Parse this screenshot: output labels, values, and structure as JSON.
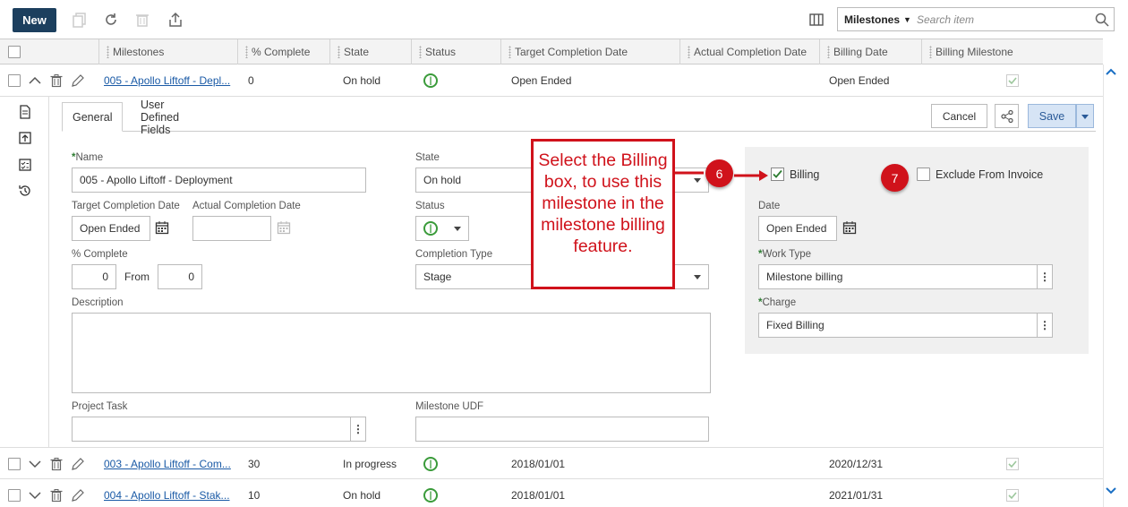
{
  "toolbar": {
    "new_label": "New",
    "search_scope": "Milestones",
    "search_placeholder": "Search item"
  },
  "columns": [
    "Milestones",
    "% Complete",
    "State",
    "Status",
    "Target Completion Date",
    "Actual Completion Date",
    "Billing Date",
    "Billing Milestone"
  ],
  "rows": [
    {
      "milestone": "005 - Apollo Liftoff - Depl...",
      "complete": "0",
      "state": "On hold",
      "target": "Open Ended",
      "actual": "",
      "billing_date": "Open Ended",
      "billing": true
    },
    {
      "milestone": "003 - Apollo Liftoff - Com...",
      "complete": "30",
      "state": "In progress",
      "target": "2018/01/01",
      "actual": "",
      "billing_date": "2020/12/31",
      "billing": true
    },
    {
      "milestone": "004 - Apollo Liftoff - Stak...",
      "complete": "10",
      "state": "On hold",
      "target": "2018/01/01",
      "actual": "",
      "billing_date": "2021/01/31",
      "billing": true
    }
  ],
  "tabs": {
    "general": "General",
    "udf": "User Defined Fields"
  },
  "actions": {
    "cancel": "Cancel",
    "save": "Save"
  },
  "form": {
    "name_label": "Name",
    "name_value": "005 - Apollo Liftoff - Deployment",
    "target_label": "Target Completion Date",
    "target_value": "Open Ended",
    "actual_label": "Actual Completion Date",
    "actual_value": "",
    "complete_label": "% Complete",
    "complete_value": "0",
    "from_label": "From",
    "from_value": "0",
    "description_label": "Description",
    "project_task_label": "Project Task",
    "milestone_udf_label": "Milestone UDF",
    "state_label": "State",
    "state_value": "On hold",
    "status_label": "Status",
    "completion_type_label": "Completion Type",
    "completion_type_value": "Stage",
    "billing_label": "Billing",
    "exclude_label": "Exclude From Invoice",
    "date_label": "Date",
    "date_value": "Open Ended",
    "work_type_label": "Work Type",
    "work_type_value": "Milestone billing",
    "charge_label": "Charge",
    "charge_value": "Fixed Billing",
    "billing_checked": true,
    "exclude_checked": false
  },
  "callout": {
    "text": "Select the Billing box, to use this milestone in the milestone billing feature.",
    "step6": "6",
    "step7": "7"
  },
  "colors": {
    "accent_red": "#d0121b",
    "nav_dark": "#1c3f5e",
    "status_green": "#3a9b3a"
  }
}
